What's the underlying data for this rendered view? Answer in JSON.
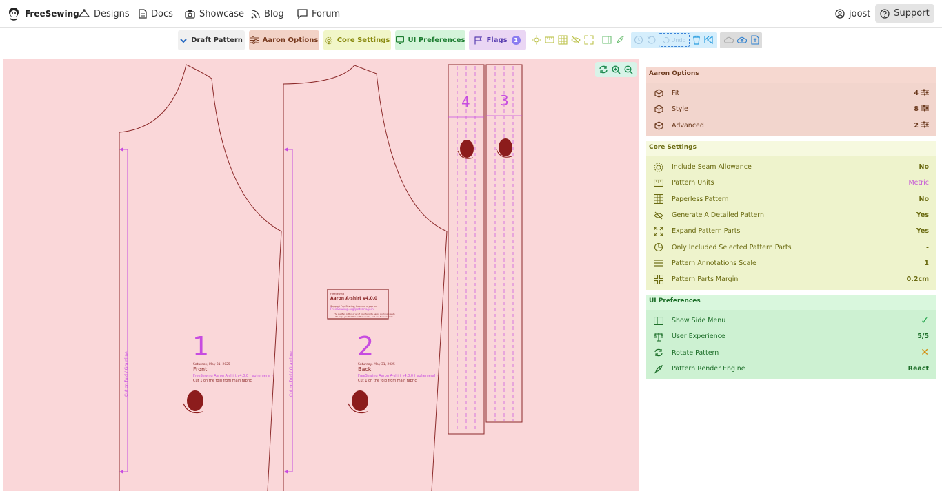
{
  "nav": {
    "brand": "FreeSewing",
    "items": [
      {
        "label": "Designs"
      },
      {
        "label": "Docs"
      },
      {
        "label": "Showcase"
      },
      {
        "label": "Blog"
      },
      {
        "label": "Forum"
      }
    ],
    "user": "joost",
    "support": "Support"
  },
  "toolbar": {
    "draft_pattern": "Draft Pattern",
    "aaron_options": "Aaron Options",
    "core_settings": "Core Settings",
    "ui_preferences": "UI Preferences",
    "flags": "Flags",
    "flags_count": "1",
    "undo": "Undo"
  },
  "pattern": {
    "parts": [
      {
        "number": "1",
        "name": "Front",
        "date": "Saturday, May 31, 2025",
        "design": "FreeSewing Aaron A-shirt v4.0.0 ( ephemeral )",
        "cut": "Cut 1 on the fold from main fabric",
        "fold": "Cut on fold / Grainline"
      },
      {
        "number": "2",
        "name": "Back",
        "date": "Saturday, May 31, 2025",
        "design": "FreeSewing Aaron A-shirt v4.0.0 ( ephemeral )",
        "cut": "Cut 1 on the fold from main fabric",
        "fold": "Cut on fold / Grainline"
      },
      {
        "number": "4"
      },
      {
        "number": "3"
      }
    ],
    "title_block": {
      "kicker": "FreeSewing",
      "title": "Aaron A-shirt v4.0.0",
      "support": "Support FreeSewing, become a patron",
      "url": "FreeSewing.org/patrons/join",
      "note1": "The purified cotton of all of your favorite Aaron clothing brands",
      "note2": "We hope you find this pattern useful, and use it responsibly"
    }
  },
  "aaron_options": {
    "title": "Aaron Options",
    "rows": [
      {
        "label": "Fit",
        "value": "4"
      },
      {
        "label": "Style",
        "value": "8"
      },
      {
        "label": "Advanced",
        "value": "2"
      }
    ]
  },
  "core_settings": {
    "title": "Core Settings",
    "rows": [
      {
        "label": "Include Seam Allowance",
        "value": "No"
      },
      {
        "label": "Pattern Units",
        "value": "Metric"
      },
      {
        "label": "Paperless Pattern",
        "value": "No"
      },
      {
        "label": "Generate A Detailed Pattern",
        "value": "Yes"
      },
      {
        "label": "Expand Pattern Parts",
        "value": "Yes"
      },
      {
        "label": "Only Included Selected Pattern Parts",
        "value": "-"
      },
      {
        "label": "Pattern Annotations Scale",
        "value": "1"
      },
      {
        "label": "Pattern Parts Margin",
        "value": "0.2cm"
      }
    ]
  },
  "ui_preferences": {
    "title": "UI Preferences",
    "rows": [
      {
        "label": "Show Side Menu",
        "value": "✓"
      },
      {
        "label": "User Experience",
        "value": "5/5"
      },
      {
        "label": "Rotate Pattern",
        "value": "✕"
      },
      {
        "label": "Pattern Render Engine",
        "value": "React"
      }
    ]
  },
  "colors": {
    "canvas": "#fad7d9",
    "pattern_line": "#8c2a2a",
    "accent_purple": "#c74ce0",
    "aaron": "#6c3a1e",
    "core": "#6a6a10",
    "ui": "#1e6f2a"
  }
}
